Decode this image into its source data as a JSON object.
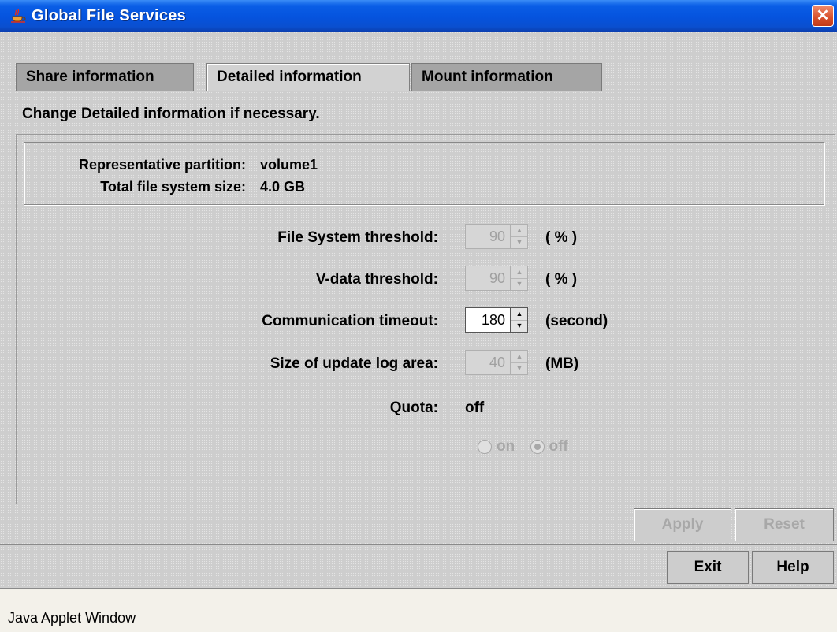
{
  "window": {
    "title": "Global File Services",
    "close_label": "✕",
    "icon": "java-coffee-icon"
  },
  "tabs": [
    {
      "label": "Share information",
      "active": false
    },
    {
      "label": "Detailed information",
      "active": true
    },
    {
      "label": "Mount information",
      "active": false
    }
  ],
  "instruction": "Change Detailed information if necessary.",
  "info": {
    "partition_label": "Representative partition:",
    "partition_value": "volume1",
    "size_label": "Total file system size:",
    "size_value": "4.0 GB"
  },
  "settings": {
    "fs_threshold": {
      "label": "File System threshold:",
      "value": "90",
      "unit": "( % )",
      "enabled": false
    },
    "vdata_threshold": {
      "label": "V-data threshold:",
      "value": "90",
      "unit": "( % )",
      "enabled": false
    },
    "comm_timeout": {
      "label": "Communication timeout:",
      "value": "180",
      "unit": "(second)",
      "enabled": true
    },
    "update_log": {
      "label": "Size of update log area:",
      "value": "40",
      "unit": "(MB)",
      "enabled": false
    }
  },
  "quota": {
    "label": "Quota:",
    "value": "off",
    "options": [
      {
        "label": "on",
        "checked": false
      },
      {
        "label": "off",
        "checked": true
      }
    ],
    "enabled": false
  },
  "buttons": {
    "apply": "Apply",
    "reset": "Reset",
    "exit": "Exit",
    "help": "Help"
  },
  "status": "Java Applet Window"
}
